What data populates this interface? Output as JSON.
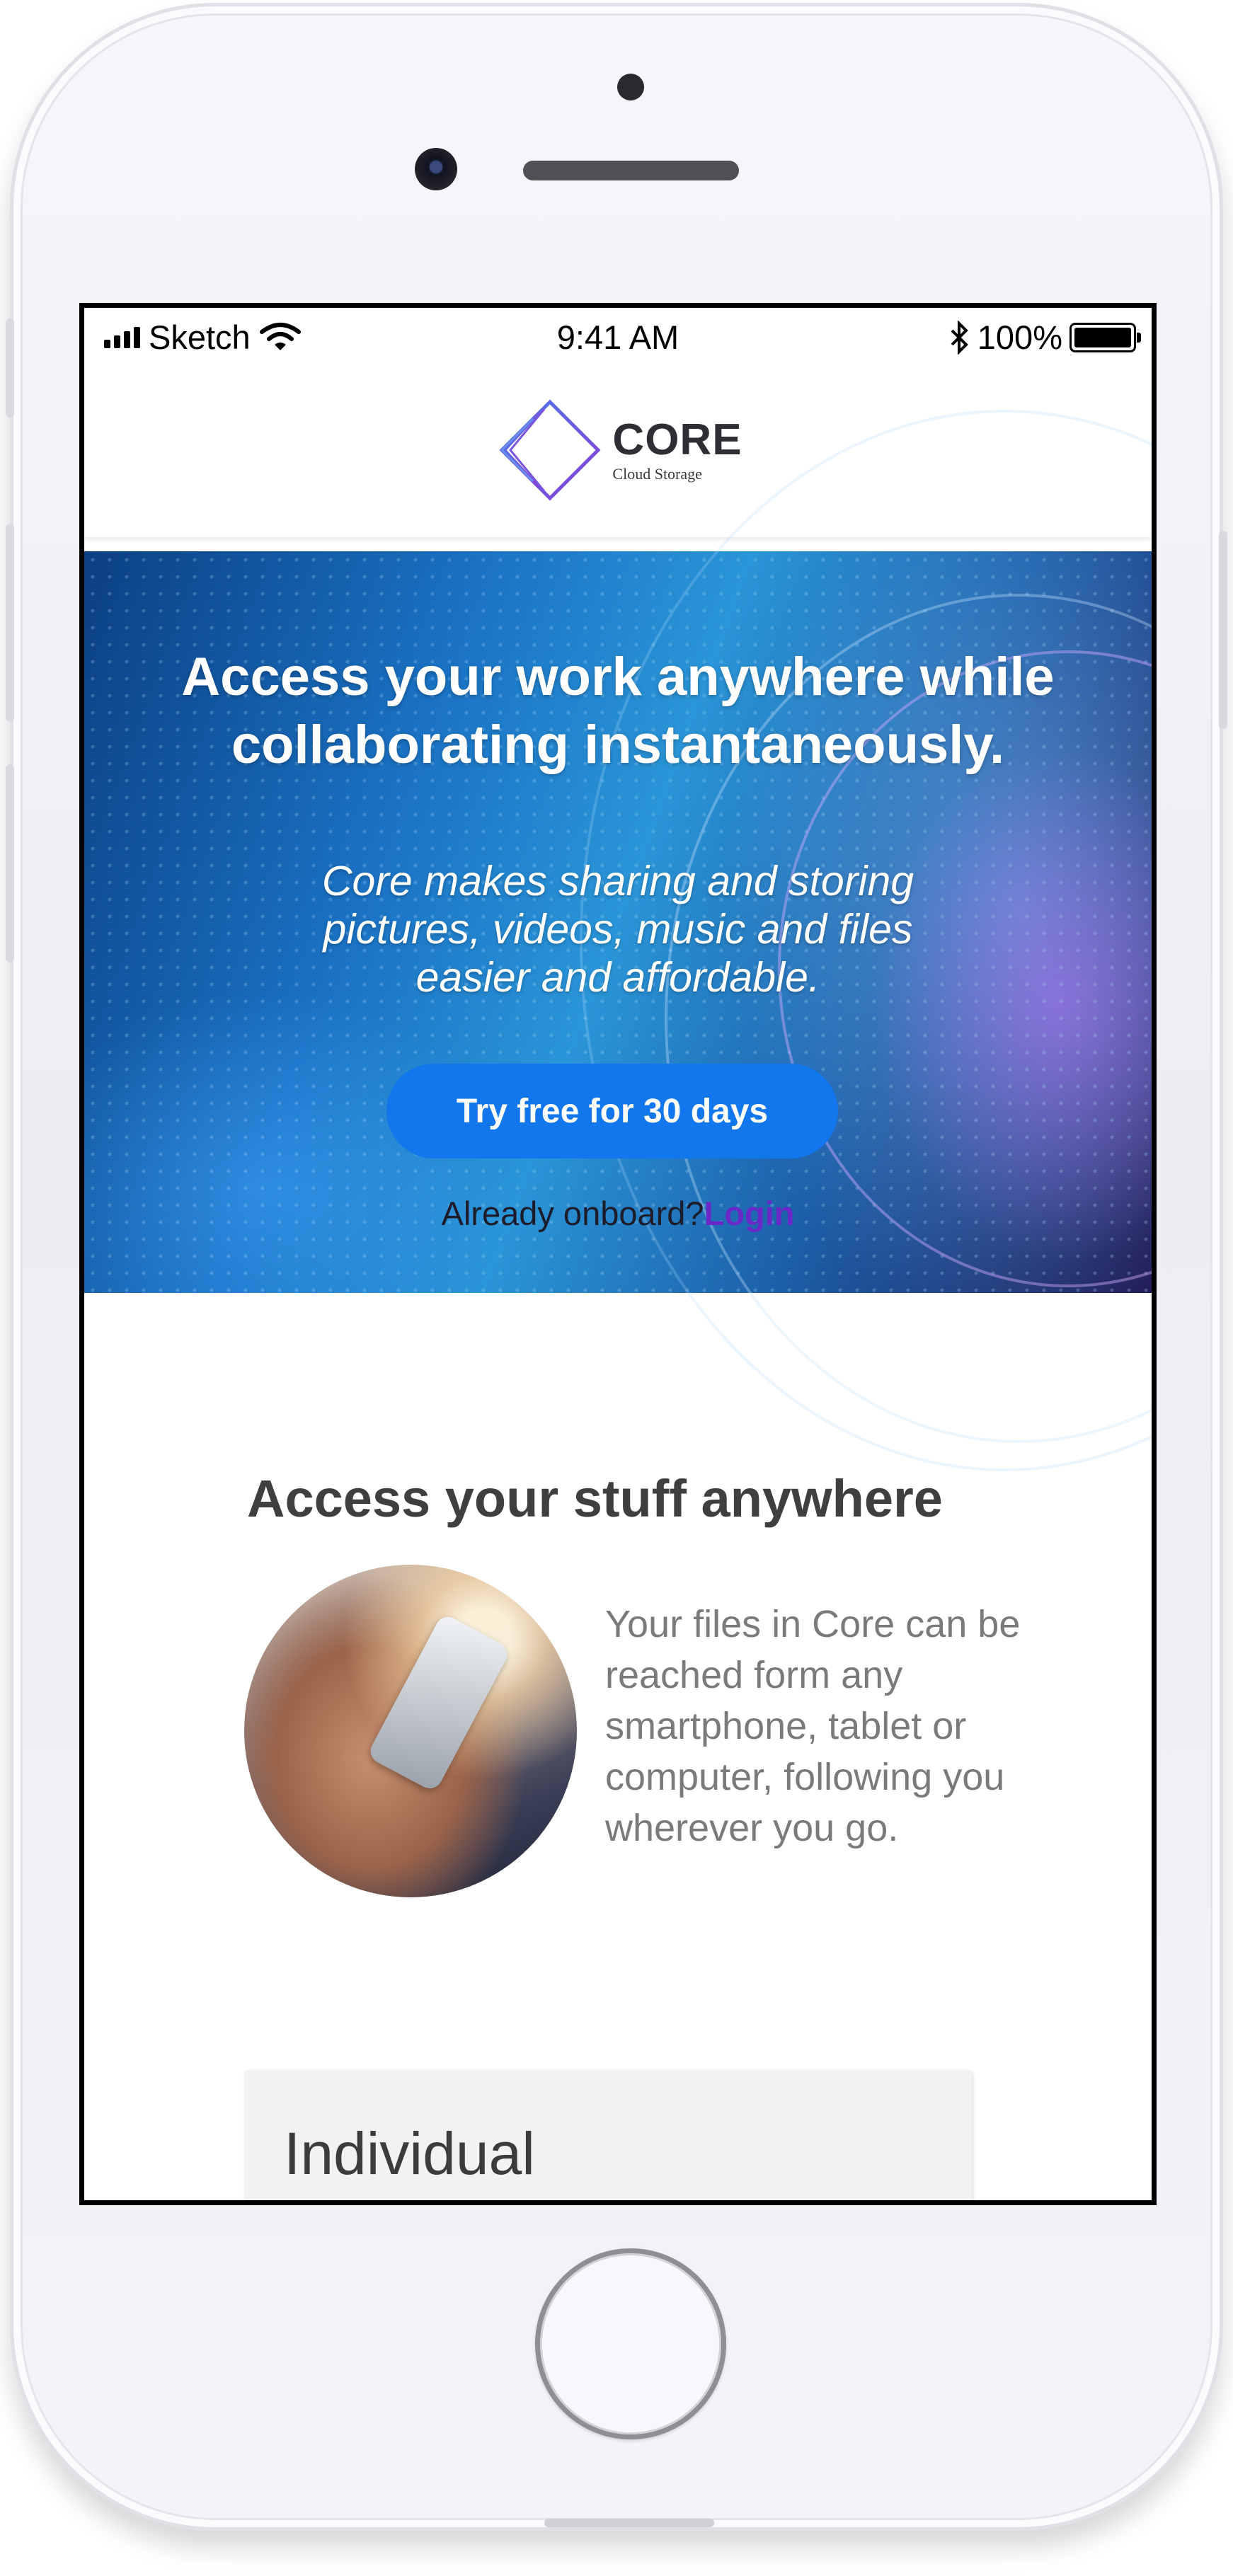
{
  "status_bar": {
    "carrier": "Sketch",
    "time": "9:41 AM",
    "battery": "100%",
    "battery_level": 1.0
  },
  "header": {
    "logo_title": "CORE",
    "logo_subtitle": "Cloud Storage",
    "logo_icon": "diamond-logo-icon"
  },
  "hero": {
    "title": "Access your work anywhere while collaborating instantaneously.",
    "subtitle": "Core makes sharing and storing pictures, videos, music and files easier and affordable.",
    "cta_label": "Try free for 30 days",
    "onboard_text": "Already onboard?",
    "login_label": "Login"
  },
  "features": {
    "title": "Access your stuff anywhere",
    "description": "Your files in Core can be reached form any smartphone, tablet or computer, following you wherever you go."
  },
  "pricing": {
    "card_title": "Individual"
  },
  "colors": {
    "cta": "#1276ec",
    "login": "#6a28c8"
  }
}
